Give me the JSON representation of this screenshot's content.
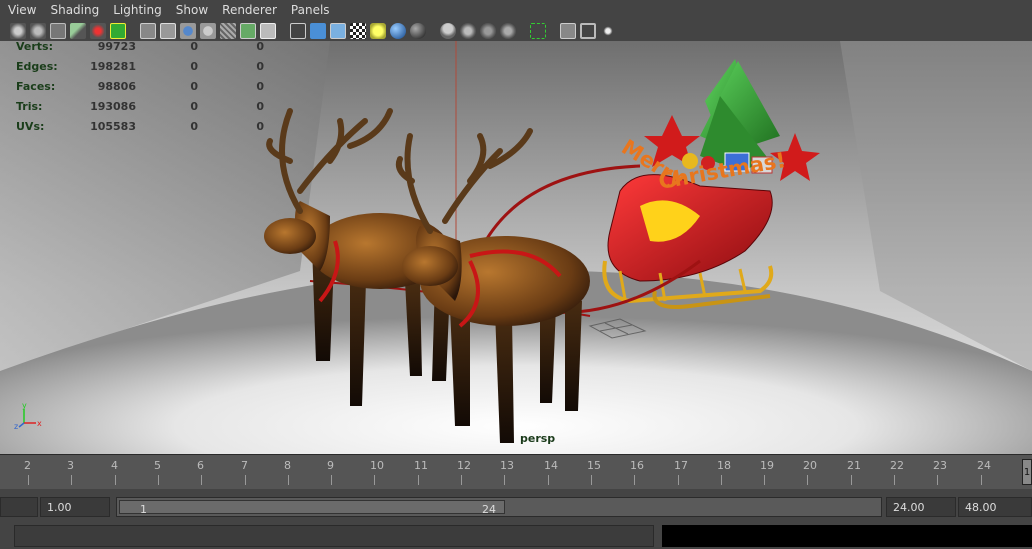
{
  "menu": [
    "View",
    "Shading",
    "Lighting",
    "Show",
    "Renderer",
    "Panels"
  ],
  "toolbar_icons": [
    "select-camera-icon",
    "camera-attributes-icon",
    "bookmark-icon",
    "image-plane-icon",
    "2d-pan-icon",
    "grid-icon",
    "film-gate-icon",
    "resolution-gate-icon",
    "field-chart-icon",
    "safe-action-icon",
    "wireframe-icon",
    "smooth-shade-icon",
    "flat-shade-icon",
    "bounding-box-icon",
    "texture-icon",
    "lights-icon",
    "isolate-icon",
    "xray-icon",
    "backface-icon",
    "shadow-icon",
    "ambient-occlusion-icon",
    "motion-blur-icon",
    "antialias-icon",
    "depth-of-field-icon",
    "select-icon",
    "frame-icon",
    "single-view-icon",
    "share-icon"
  ],
  "hud": {
    "rows": [
      {
        "label": "Verts:",
        "value": "99723",
        "c1": "0",
        "c2": "0"
      },
      {
        "label": "Edges:",
        "value": "198281",
        "c1": "0",
        "c2": "0"
      },
      {
        "label": "Faces:",
        "value": "98806",
        "c1": "0",
        "c2": "0"
      },
      {
        "label": "Tris:",
        "value": "193086",
        "c1": "0",
        "c2": "0"
      },
      {
        "label": "UVs:",
        "value": "105583",
        "c1": "0",
        "c2": "0"
      }
    ]
  },
  "camera_label": "persp",
  "axis": {
    "x": "x",
    "y": "y",
    "z": "z"
  },
  "timeline": {
    "ticks": [
      "2",
      "3",
      "4",
      "5",
      "6",
      "7",
      "8",
      "9",
      "10",
      "11",
      "12",
      "13",
      "14",
      "15",
      "16",
      "17",
      "18",
      "19",
      "20",
      "21",
      "22",
      "23",
      "24"
    ],
    "current": "1"
  },
  "range": {
    "start_field": "",
    "anim_start": "1.00",
    "range_start": "1",
    "range_end": "24",
    "end_field": "24.00",
    "anim_end": "48.00"
  },
  "colors": {
    "ui_bg": "#444444",
    "hud_green": "#1a3d1a",
    "sleigh_red": "#c8141a",
    "tree_green": "#2e8b2e",
    "text_orange": "#e8761e"
  }
}
